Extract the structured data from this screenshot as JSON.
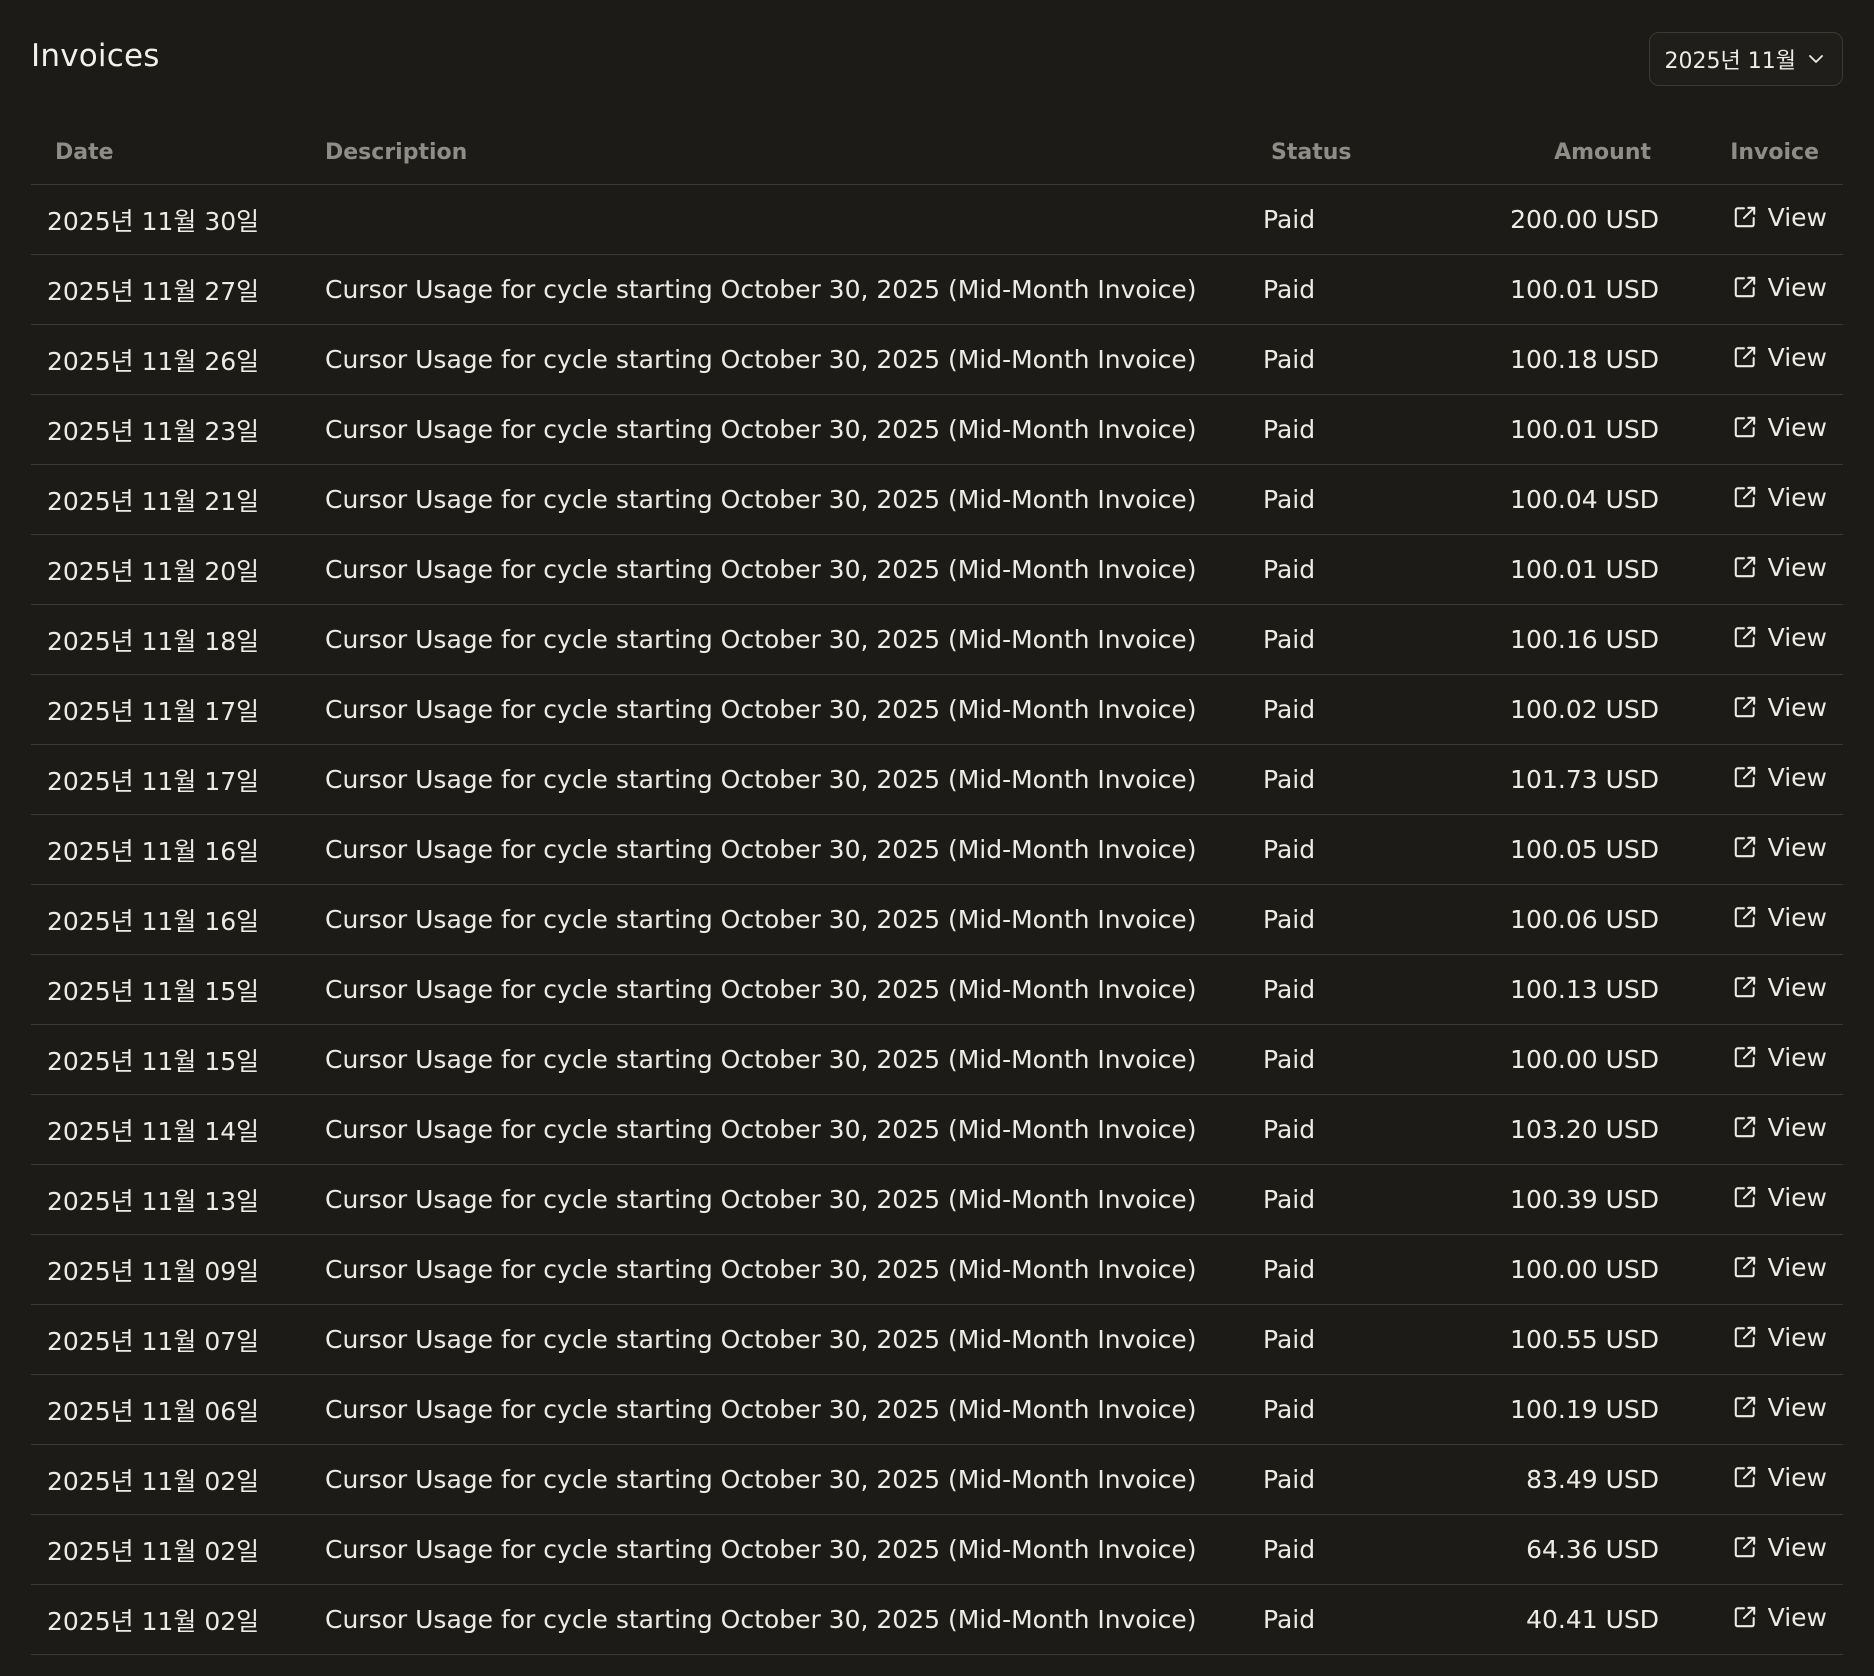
{
  "header": {
    "title": "Invoices",
    "month_selector": {
      "value": "2025년 11월",
      "icon": "chevron-down-icon"
    }
  },
  "table": {
    "columns": {
      "date": "Date",
      "description": "Description",
      "status": "Status",
      "amount": "Amount",
      "invoice": "Invoice"
    },
    "view_label": "View",
    "view_icon": "external-link-icon",
    "rows": [
      {
        "date": "2025년 11월 30일",
        "description": "",
        "status": "Paid",
        "amount": "200.00 USD"
      },
      {
        "date": "2025년 11월 27일",
        "description": "Cursor Usage for cycle starting October 30, 2025 (Mid-Month Invoice)",
        "status": "Paid",
        "amount": "100.01 USD"
      },
      {
        "date": "2025년 11월 26일",
        "description": "Cursor Usage for cycle starting October 30, 2025 (Mid-Month Invoice)",
        "status": "Paid",
        "amount": "100.18 USD"
      },
      {
        "date": "2025년 11월 23일",
        "description": "Cursor Usage for cycle starting October 30, 2025 (Mid-Month Invoice)",
        "status": "Paid",
        "amount": "100.01 USD"
      },
      {
        "date": "2025년 11월 21일",
        "description": "Cursor Usage for cycle starting October 30, 2025 (Mid-Month Invoice)",
        "status": "Paid",
        "amount": "100.04 USD"
      },
      {
        "date": "2025년 11월 20일",
        "description": "Cursor Usage for cycle starting October 30, 2025 (Mid-Month Invoice)",
        "status": "Paid",
        "amount": "100.01 USD"
      },
      {
        "date": "2025년 11월 18일",
        "description": "Cursor Usage for cycle starting October 30, 2025 (Mid-Month Invoice)",
        "status": "Paid",
        "amount": "100.16 USD"
      },
      {
        "date": "2025년 11월 17일",
        "description": "Cursor Usage for cycle starting October 30, 2025 (Mid-Month Invoice)",
        "status": "Paid",
        "amount": "100.02 USD"
      },
      {
        "date": "2025년 11월 17일",
        "description": "Cursor Usage for cycle starting October 30, 2025 (Mid-Month Invoice)",
        "status": "Paid",
        "amount": "101.73 USD"
      },
      {
        "date": "2025년 11월 16일",
        "description": "Cursor Usage for cycle starting October 30, 2025 (Mid-Month Invoice)",
        "status": "Paid",
        "amount": "100.05 USD"
      },
      {
        "date": "2025년 11월 16일",
        "description": "Cursor Usage for cycle starting October 30, 2025 (Mid-Month Invoice)",
        "status": "Paid",
        "amount": "100.06 USD"
      },
      {
        "date": "2025년 11월 15일",
        "description": "Cursor Usage for cycle starting October 30, 2025 (Mid-Month Invoice)",
        "status": "Paid",
        "amount": "100.13 USD"
      },
      {
        "date": "2025년 11월 15일",
        "description": "Cursor Usage for cycle starting October 30, 2025 (Mid-Month Invoice)",
        "status": "Paid",
        "amount": "100.00 USD"
      },
      {
        "date": "2025년 11월 14일",
        "description": "Cursor Usage for cycle starting October 30, 2025 (Mid-Month Invoice)",
        "status": "Paid",
        "amount": "103.20 USD"
      },
      {
        "date": "2025년 11월 13일",
        "description": "Cursor Usage for cycle starting October 30, 2025 (Mid-Month Invoice)",
        "status": "Paid",
        "amount": "100.39 USD"
      },
      {
        "date": "2025년 11월 09일",
        "description": "Cursor Usage for cycle starting October 30, 2025 (Mid-Month Invoice)",
        "status": "Paid",
        "amount": "100.00 USD"
      },
      {
        "date": "2025년 11월 07일",
        "description": "Cursor Usage for cycle starting October 30, 2025 (Mid-Month Invoice)",
        "status": "Paid",
        "amount": "100.55 USD"
      },
      {
        "date": "2025년 11월 06일",
        "description": "Cursor Usage for cycle starting October 30, 2025 (Mid-Month Invoice)",
        "status": "Paid",
        "amount": "100.19 USD"
      },
      {
        "date": "2025년 11월 02일",
        "description": "Cursor Usage for cycle starting October 30, 2025 (Mid-Month Invoice)",
        "status": "Paid",
        "amount": "83.49 USD"
      },
      {
        "date": "2025년 11월 02일",
        "description": "Cursor Usage for cycle starting October 30, 2025 (Mid-Month Invoice)",
        "status": "Paid",
        "amount": "64.36 USD"
      },
      {
        "date": "2025년 11월 02일",
        "description": "Cursor Usage for cycle starting October 30, 2025 (Mid-Month Invoice)",
        "status": "Paid",
        "amount": "40.41 USD"
      }
    ]
  }
}
